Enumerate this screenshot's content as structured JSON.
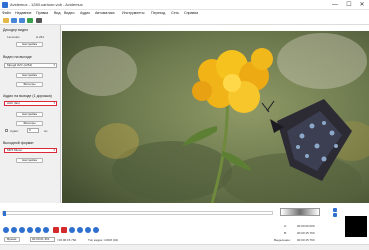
{
  "window": {
    "title": "Avidemux - 1280.cartoon.vob - Avidemux",
    "minimize": "—",
    "maximize": "☐",
    "close": "✕"
  },
  "menu": [
    "Файл",
    "Недавние",
    "Правка",
    "Вид",
    "Видео",
    "Аудио",
    "Автоматика",
    "Инструменты",
    "Переход",
    "Сеть",
    "Справка"
  ],
  "toolbar": {
    "icons": [
      "open-icon",
      "info-icon",
      "save-icon",
      "properties-icon",
      "calculator-icon"
    ]
  },
  "left_panel": {
    "decoder": {
      "title": "Декодер видео",
      "row_label": "Lavcodec",
      "row_value": "H.264",
      "button": "Настройка"
    },
    "video_output": {
      "title": "Видео на выходе",
      "combo": "Mpeg4 AVC (x264)",
      "config_button": "Настройка",
      "filters_button": "Фильтры"
    },
    "audio_output": {
      "title": "Аудио на выходе (1 дорожка)",
      "combo": "AAC (lav)",
      "config_button": "Настройка",
      "filters_button": "Фильтры",
      "shift_label": "Сдвиг:",
      "shift_value": "0",
      "shift_unit": "мс"
    },
    "output_format": {
      "title": "Выходной формат",
      "combo": "MP4 Muxer",
      "config_button": "Настройка"
    }
  },
  "bottom": {
    "time_label": "Время:",
    "current_time": "00:00:01.301",
    "total_time": "/ 00:00:15.760",
    "frame_type": "Тип кадра:  I-FRM (02)",
    "marker_a_label": "A:",
    "marker_a_value": "00:00:00.000",
    "marker_b_label": "B:",
    "marker_b_value": "00:00:15.760",
    "selection_label": "Выделение:",
    "selection_value": "00:00:15.760"
  },
  "colors": {
    "accent": "#2f6fd0",
    "highlight": "#e0263a"
  }
}
